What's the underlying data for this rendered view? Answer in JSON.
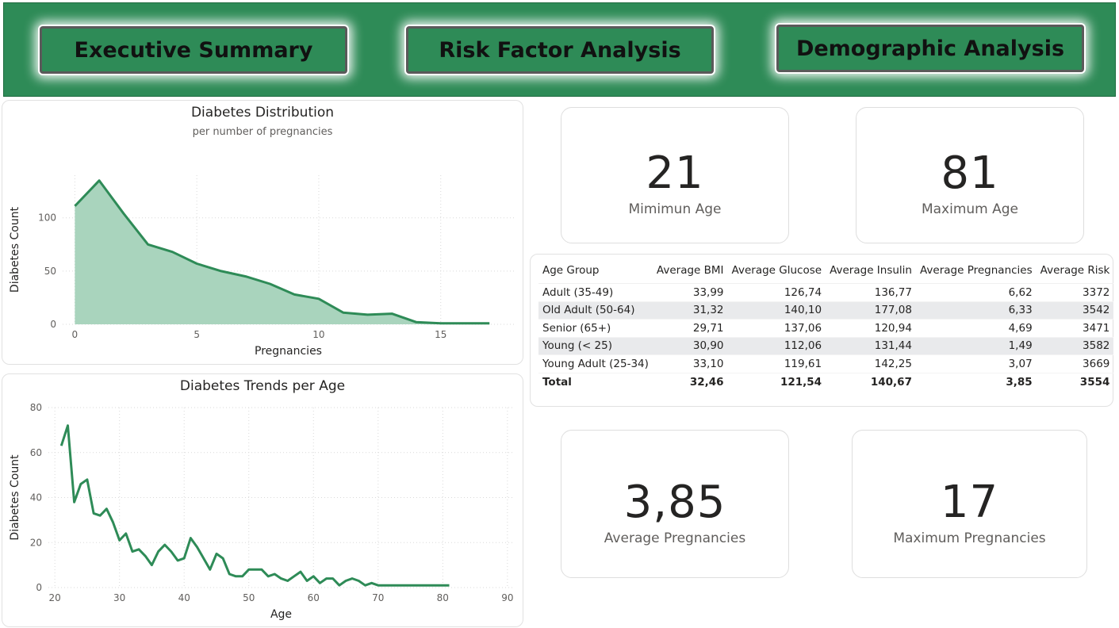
{
  "nav": {
    "executive_summary": "Executive Summary",
    "risk_factor_analysis": "Risk Factor Analysis",
    "demographic_analysis": "Demographic Analysis"
  },
  "colors": {
    "header_bg": "#2e8b57",
    "series_line": "#2e8b57",
    "area_fill": "#a9d4bd"
  },
  "cards": {
    "min_age": {
      "value": "21",
      "label": "Mimimun Age"
    },
    "max_age": {
      "value": "81",
      "label": "Maximum Age"
    },
    "avg_pregnancies": {
      "value": "3,85",
      "label": "Average Pregnancies"
    },
    "max_pregnancies": {
      "value": "17",
      "label": "Maximum Pregnancies"
    }
  },
  "table": {
    "columns": [
      "Age Group",
      "Average BMI",
      "Average Glucose",
      "Average Insulin",
      "Average Pregnancies",
      "Average Risk"
    ],
    "rows": [
      [
        "Adult (35-49)",
        "33,99",
        "126,74",
        "136,77",
        "6,62",
        "3372"
      ],
      [
        "Old Adult (50-64)",
        "31,32",
        "140,10",
        "177,08",
        "6,33",
        "3542"
      ],
      [
        "Senior (65+)",
        "29,71",
        "137,06",
        "120,94",
        "4,69",
        "3471"
      ],
      [
        "Young (< 25)",
        "30,90",
        "112,06",
        "131,44",
        "1,49",
        "3582"
      ],
      [
        "Young Adult (25-34)",
        "33,10",
        "119,61",
        "142,25",
        "3,07",
        "3669"
      ]
    ],
    "total": [
      "Total",
      "32,46",
      "121,54",
      "140,67",
      "3,85",
      "3554"
    ]
  },
  "chart_data": [
    {
      "type": "area",
      "title": "Diabetes Distribution",
      "subtitle": "per number of pregnancies",
      "xlabel": "Pregnancies",
      "ylabel": "Diabetes Count",
      "xlim": [
        -0.5,
        18
      ],
      "ylim": [
        0,
        140
      ],
      "xticks": [
        0,
        5,
        10,
        15
      ],
      "yticks": [
        0,
        50,
        100
      ],
      "grid": true,
      "x": [
        0,
        1,
        2,
        3,
        4,
        5,
        6,
        7,
        8,
        9,
        10,
        11,
        12,
        13,
        14,
        15,
        16,
        17
      ],
      "values": [
        111,
        135,
        104,
        75,
        68,
        57,
        50,
        45,
        38,
        28,
        24,
        11,
        9,
        10,
        2,
        1,
        1,
        1
      ]
    },
    {
      "type": "line",
      "title": "Diabetes Trends per Age",
      "xlabel": "Age",
      "ylabel": "Diabetes Count",
      "xlim": [
        19,
        91
      ],
      "ylim": [
        0,
        80
      ],
      "xticks": [
        20,
        30,
        40,
        50,
        60,
        70,
        80,
        90
      ],
      "yticks": [
        0,
        20,
        40,
        60,
        80
      ],
      "grid": true,
      "x": [
        21,
        22,
        23,
        24,
        25,
        26,
        27,
        28,
        29,
        30,
        31,
        32,
        33,
        34,
        35,
        36,
        37,
        38,
        39,
        40,
        41,
        42,
        43,
        44,
        45,
        46,
        47,
        48,
        49,
        50,
        51,
        52,
        53,
        54,
        55,
        56,
        57,
        58,
        59,
        60,
        61,
        62,
        63,
        64,
        65,
        66,
        67,
        68,
        69,
        70,
        71,
        72,
        73,
        74,
        75,
        76,
        77,
        78,
        79,
        80,
        81
      ],
      "values": [
        63,
        72,
        38,
        46,
        48,
        33,
        32,
        35,
        29,
        21,
        24,
        16,
        17,
        14,
        10,
        16,
        19,
        16,
        12,
        13,
        22,
        18,
        13,
        8,
        15,
        13,
        6,
        5,
        5,
        8,
        8,
        8,
        5,
        6,
        4,
        3,
        5,
        7,
        3,
        5,
        2,
        4,
        4,
        1,
        3,
        4,
        3,
        1,
        2,
        1,
        1,
        1,
        1,
        1,
        1,
        1,
        1,
        1,
        1,
        1,
        1
      ]
    }
  ]
}
